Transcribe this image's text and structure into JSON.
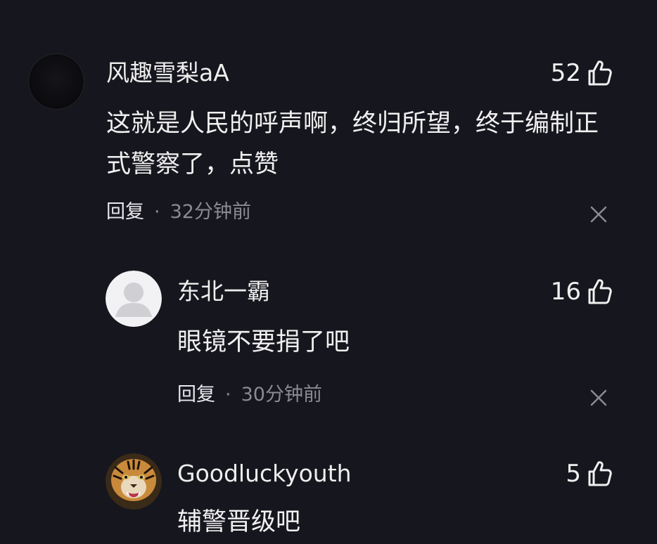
{
  "comments": [
    {
      "username": "风趣雪梨aA",
      "likes": "52",
      "text": "这就是人民的呼声啊，终归所望，终于编制正式警察了，点赞",
      "reply_label": "回复",
      "separator": "·",
      "time": "32分钟前",
      "avatar_icon": "dark-avatar-icon"
    },
    {
      "username": "东北一霸",
      "likes": "16",
      "text": "眼镜不要捐了吧",
      "reply_label": "回复",
      "separator": "·",
      "time": "30分钟前",
      "avatar_icon": "default-user-avatar-icon"
    },
    {
      "username": "Goodluckyouth",
      "likes": "5",
      "text": "辅警晋级吧",
      "avatar_icon": "tiger-avatar-icon"
    }
  ],
  "colors": {
    "background": "#16161e",
    "text": "#f0f0f0",
    "muted": "#8a8a94"
  }
}
